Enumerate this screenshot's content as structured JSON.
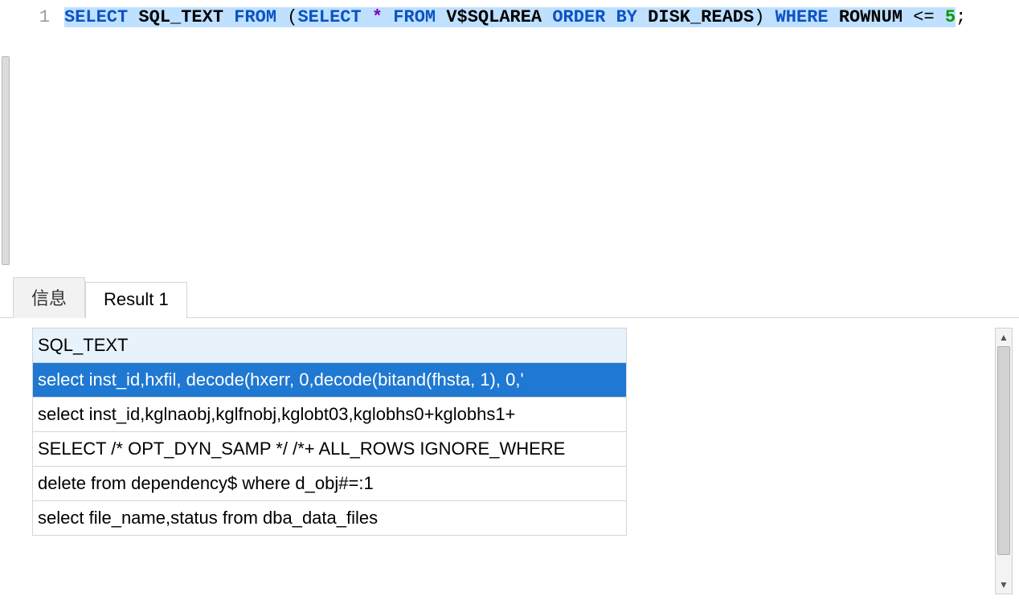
{
  "editor": {
    "line_number": "1",
    "tokens": [
      {
        "t": "SELECT",
        "c": "kw",
        "sel": true
      },
      {
        "t": " ",
        "c": "punct",
        "sel": true
      },
      {
        "t": "SQL_TEXT",
        "c": "ident",
        "sel": true
      },
      {
        "t": " ",
        "c": "punct",
        "sel": true
      },
      {
        "t": "FROM",
        "c": "kw",
        "sel": true
      },
      {
        "t": " ",
        "c": "punct",
        "sel": true
      },
      {
        "t": "(",
        "c": "punct",
        "sel": true
      },
      {
        "t": "SELECT",
        "c": "kw",
        "sel": true
      },
      {
        "t": " ",
        "c": "punct",
        "sel": true
      },
      {
        "t": "*",
        "c": "star",
        "sel": true
      },
      {
        "t": " ",
        "c": "punct",
        "sel": true
      },
      {
        "t": "FROM",
        "c": "kw",
        "sel": true
      },
      {
        "t": " ",
        "c": "punct",
        "sel": true
      },
      {
        "t": "V$SQLAREA",
        "c": "ident",
        "sel": true
      },
      {
        "t": " ",
        "c": "punct",
        "sel": true
      },
      {
        "t": "ORDER",
        "c": "kw",
        "sel": true
      },
      {
        "t": " ",
        "c": "punct",
        "sel": true
      },
      {
        "t": "BY",
        "c": "kw",
        "sel": true
      },
      {
        "t": " ",
        "c": "punct",
        "sel": true
      },
      {
        "t": "DISK_READS",
        "c": "ident",
        "sel": true
      },
      {
        "t": ")",
        "c": "punct",
        "sel": true
      },
      {
        "t": " ",
        "c": "punct",
        "sel": true
      },
      {
        "t": "WHERE",
        "c": "kw",
        "sel": true
      },
      {
        "t": " ",
        "c": "punct",
        "sel": true
      },
      {
        "t": "ROWNUM",
        "c": "ident",
        "sel": true
      },
      {
        "t": " <= ",
        "c": "punct",
        "sel": true
      },
      {
        "t": "5",
        "c": "num",
        "sel": true
      },
      {
        "t": ";",
        "c": "semi",
        "sel": false
      }
    ]
  },
  "tabs": {
    "info_label": "信息",
    "result_label": "Result 1"
  },
  "grid": {
    "column_header": "SQL_TEXT",
    "rows": [
      "select inst_id,hxfil, decode(hxerr, 0,decode(bitand(fhsta, 1), 0,'",
      "select inst_id,kglnaobj,kglfnobj,kglobt03,kglobhs0+kglobhs1+",
      "SELECT /* OPT_DYN_SAMP */ /*+ ALL_ROWS IGNORE_WHERE",
      "delete from dependency$ where d_obj#=:1",
      "select file_name,status from dba_data_files"
    ],
    "selected_index": 0
  },
  "scroll": {
    "up_glyph": "▲",
    "down_glyph": "▼"
  }
}
